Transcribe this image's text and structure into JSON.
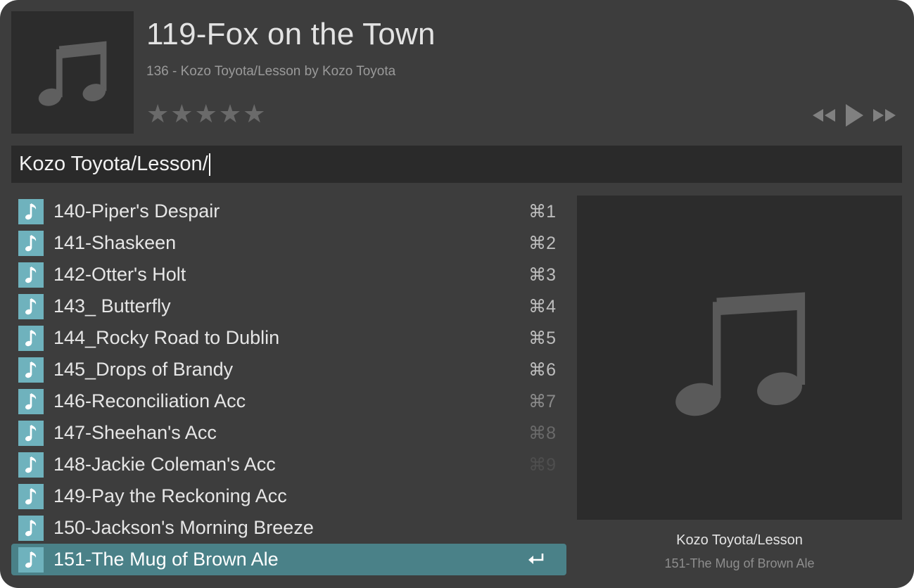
{
  "now_playing": {
    "title": "119-Fox on the Town",
    "subtitle": "136 - Kozo Toyota/Lesson by Kozo Toyota",
    "rating": 0,
    "rating_max": 5,
    "artwork_icon": "music-note-icon"
  },
  "controls": {
    "previous_icon": "rewind-icon",
    "play_icon": "play-icon",
    "next_icon": "fast-forward-icon"
  },
  "search": {
    "query": "Kozo Toyota/Lesson/"
  },
  "results": [
    {
      "label": "140-Piper's Despair",
      "shortcut": "⌘1"
    },
    {
      "label": "141-Shaskeen",
      "shortcut": "⌘2"
    },
    {
      "label": "142-Otter's Holt",
      "shortcut": "⌘3"
    },
    {
      "label": "143_ Butterfly",
      "shortcut": "⌘4"
    },
    {
      "label": "144_Rocky Road to Dublin",
      "shortcut": "⌘5"
    },
    {
      "label": "145_Drops of Brandy",
      "shortcut": "⌘6"
    },
    {
      "label": "146-Reconciliation Acc",
      "shortcut": "⌘7"
    },
    {
      "label": "147-Sheehan's Acc",
      "shortcut": "⌘8"
    },
    {
      "label": "148-Jackie Coleman's Acc",
      "shortcut": "⌘9"
    },
    {
      "label": "149-Pay the Reckoning Acc",
      "shortcut": ""
    },
    {
      "label": "150-Jackson's Morning Breeze",
      "shortcut": ""
    },
    {
      "label": "151-The Mug of Brown Ale",
      "shortcut": "",
      "selected": true,
      "action_icon": "return-icon"
    }
  ],
  "preview": {
    "album": "Kozo Toyota/Lesson",
    "track": "151-The Mug of Brown Ale",
    "artwork_icon": "music-note-icon"
  },
  "colors": {
    "background": "#3d3d3d",
    "selection": "#4a8188",
    "icon_tile": "#6fb2bd",
    "star": "#6a6a6a"
  }
}
